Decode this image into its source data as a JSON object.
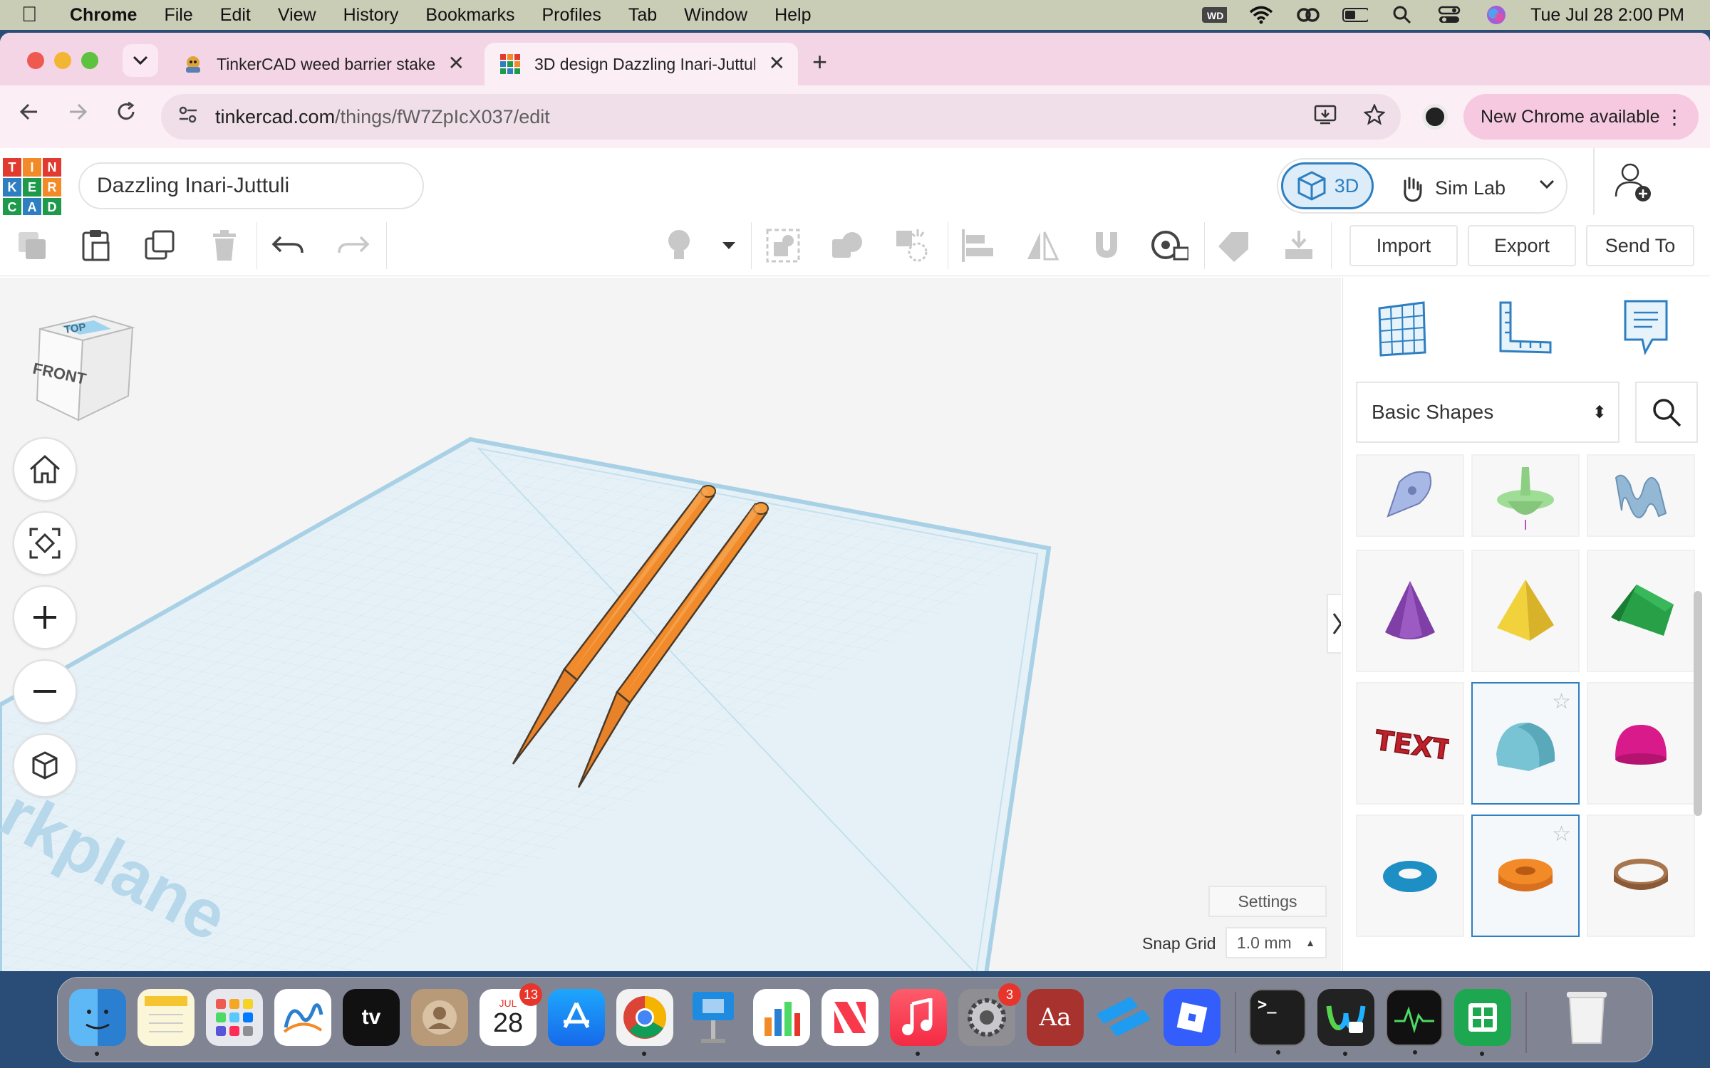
{
  "menubar": {
    "app": "Chrome",
    "items": [
      "File",
      "Edit",
      "View",
      "History",
      "Bookmarks",
      "Profiles",
      "Tab",
      "Window",
      "Help"
    ],
    "datetime": "Tue Jul 28  2:00 PM"
  },
  "tabs": [
    {
      "title": "TinkerCAD weed barrier stake",
      "active": false
    },
    {
      "title": "3D design Dazzling Inari-Juttuli",
      "active": true
    }
  ],
  "address": {
    "host": "tinkercad.com",
    "path": "/things/fW7ZpIcX037/edit"
  },
  "chrome_update": "New Chrome available",
  "tinkercad": {
    "logo_letters": [
      "T",
      "I",
      "N",
      "K",
      "E",
      "R",
      "C",
      "A",
      "D"
    ],
    "design_name": "Dazzling Inari-Juttuli",
    "mode_3d": "3D",
    "mode_sim": "Sim Lab",
    "toolbar_buttons": {
      "import": "Import",
      "export": "Export",
      "send_to": "Send To"
    },
    "viewcube": {
      "top": "TOP",
      "front": "FRONT"
    },
    "workplane_label": "rkplane",
    "settings": "Settings",
    "snap_grid_label": "Snap Grid",
    "snap_grid_value": "1.0 mm",
    "shapes_category": "Basic Shapes",
    "text_shape": "TEXT"
  },
  "dock": {
    "calendar_month": "JUL",
    "calendar_day": "28",
    "calendar_badge": "13",
    "settings_badge": "3"
  }
}
